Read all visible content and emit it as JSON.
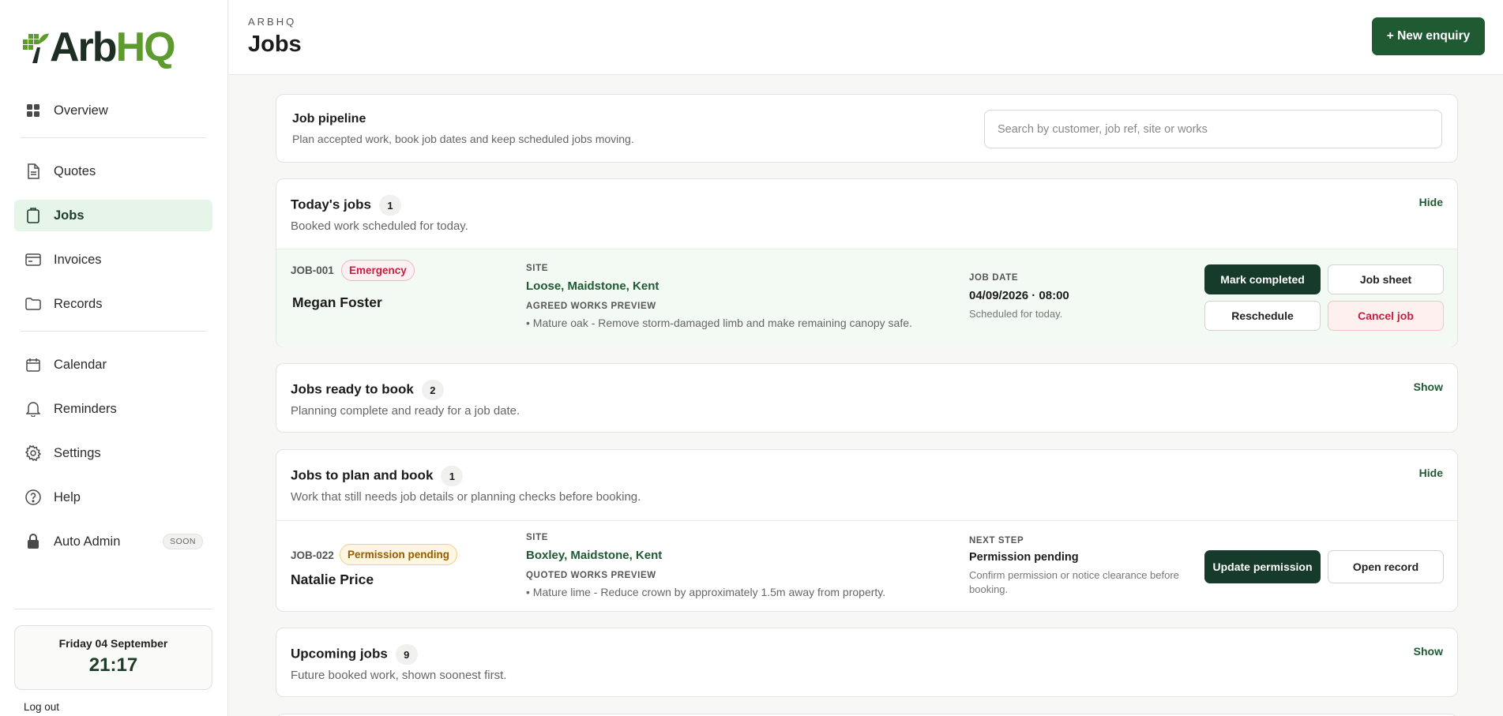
{
  "brand": {
    "logo_arb": "Arb",
    "logo_hq": "HQ"
  },
  "sidebar": {
    "items": [
      {
        "label": "Overview",
        "icon": "grid-icon"
      },
      {
        "label": "Quotes",
        "icon": "document-icon"
      },
      {
        "label": "Jobs",
        "icon": "clipboard-icon",
        "active": true
      },
      {
        "label": "Invoices",
        "icon": "invoice-icon"
      },
      {
        "label": "Records",
        "icon": "folder-icon"
      },
      {
        "label": "Calendar",
        "icon": "calendar-icon"
      },
      {
        "label": "Reminders",
        "icon": "bell-icon"
      },
      {
        "label": "Settings",
        "icon": "gear-icon"
      },
      {
        "label": "Help",
        "icon": "help-icon"
      },
      {
        "label": "Auto Admin",
        "icon": "lock-icon",
        "badge": "SOON"
      }
    ],
    "clock": {
      "date": "Friday 04 September",
      "time": "21:17"
    },
    "logout": "Log out"
  },
  "header": {
    "eyebrow": "ARBHQ",
    "title": "Jobs",
    "new_button": "+ New enquiry"
  },
  "pipeline": {
    "title": "Job pipeline",
    "subtitle": "Plan accepted work, book job dates and keep scheduled jobs moving.",
    "search_placeholder": "Search by customer, job ref, site or works"
  },
  "sections": {
    "today": {
      "title": "Today's jobs",
      "count": "1",
      "subtitle": "Booked work scheduled for today.",
      "toggle": "Hide",
      "job": {
        "ref": "JOB-001",
        "tag": "Emergency",
        "customer": "Megan Foster",
        "site_label": "SITE",
        "site": "Loose, Maidstone, Kent",
        "preview_label": "AGREED WORKS PREVIEW",
        "preview": "• Mature oak - Remove storm-damaged limb and make remaining canopy safe.",
        "date_label": "JOB DATE",
        "date": "04/09/2026 · 08:00",
        "date_note": "Scheduled for today.",
        "buttons": {
          "complete": "Mark completed",
          "sheet": "Job sheet",
          "reschedule": "Reschedule",
          "cancel": "Cancel job"
        }
      }
    },
    "ready": {
      "title": "Jobs ready to book",
      "count": "2",
      "subtitle": "Planning complete and ready for a job date.",
      "toggle": "Show"
    },
    "plan": {
      "title": "Jobs to plan and book",
      "count": "1",
      "subtitle": "Work that still needs job details or planning checks before booking.",
      "toggle": "Hide",
      "job": {
        "ref": "JOB-022",
        "tag": "Permission pending",
        "customer": "Natalie Price",
        "site_label": "SITE",
        "site": "Boxley, Maidstone, Kent",
        "preview_label": "QUOTED WORKS PREVIEW",
        "preview": "• Mature lime - Reduce crown by approximately 1.5m away from property.",
        "step_label": "NEXT STEP",
        "step": "Permission pending",
        "step_note": "Confirm permission or notice clearance before booking.",
        "buttons": {
          "update": "Update permission",
          "open": "Open record"
        }
      }
    },
    "upcoming": {
      "title": "Upcoming jobs",
      "count": "9",
      "subtitle": "Future booked work, shown soonest first.",
      "toggle": "Show"
    }
  },
  "colors": {
    "brand_green": "#1f5a32",
    "dark_green": "#173b2a",
    "active_bg": "#e6f4e9",
    "emergency": "#c4213f",
    "permission": "#9a5b00"
  }
}
